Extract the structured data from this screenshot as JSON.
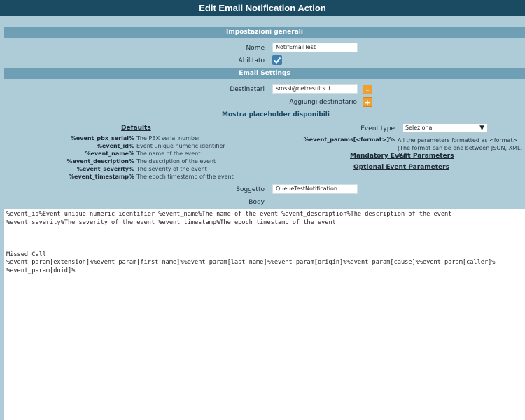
{
  "title": "Edit Email Notification Action",
  "general": {
    "header": "Impostazioni generali",
    "name_label": "Nome",
    "name_value": "NotifEmailTest",
    "enabled_label": "Abilitato"
  },
  "email": {
    "header": "Email Settings",
    "recipients_label": "Destinatari",
    "recipient_value": "srossi@netresults.it",
    "remove_symbol": "-",
    "add_recipient_label": "Aggiungi destinatario",
    "add_symbol": "+",
    "show_placeholders": "Mostra placeholder disponibili",
    "defaults_title": "Defaults",
    "placeholders": [
      {
        "key": "%event_pbx_serial%",
        "desc": "The PBX serial number"
      },
      {
        "key": "%event_id%",
        "desc": "Event unique numeric identifier"
      },
      {
        "key": "%event_name%",
        "desc": "The name of the event"
      },
      {
        "key": "%event_description%",
        "desc": "The description of the event"
      },
      {
        "key": "%event_severity%",
        "desc": "The severity of the event"
      },
      {
        "key": "%event_timestamp%",
        "desc": "The epoch timestamp of the event"
      }
    ],
    "event_type_label": "Event type",
    "event_type_value": "Seleziona",
    "event_params_key": "%event_params[<format>]%",
    "event_params_desc": "All the parameters formatted as <format> (The format can be one between JSON, XML, AVP)",
    "mandatory_params": "Mandatory Event Parameters",
    "optional_params": "Optional Event Parameters",
    "subject_label": "Soggetto",
    "subject_value": "QueueTestNotification",
    "body_label": "Body",
    "body_value": "%event_id%Event unique numeric identifier %event_name%The name of the event %event_description%The description of the event\n%event_severity%The severity of the event %event_timestamp%The epoch timestamp of the event\n\n\n\nMissed Call\n%event_param[extension]%%event_param[first_name]%%event_param[last_name]%%event_param[origin]%%event_param[cause]%%event_param[caller]%\n%event_param[dnid]%"
  }
}
